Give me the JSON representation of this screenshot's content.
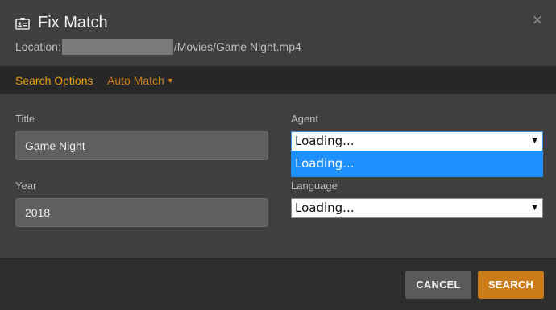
{
  "dialog": {
    "title": "Fix Match",
    "location_label": "Location:",
    "location_path": "/Movies/Game Night.mp4",
    "title_icon": "id-card-icon",
    "close_icon": "close-icon"
  },
  "tabs": {
    "search_options": "Search Options",
    "auto_match": "Auto Match"
  },
  "form": {
    "title_label": "Title",
    "title_value": "Game Night",
    "year_label": "Year",
    "year_value": "2018",
    "agent_label": "Agent",
    "agent_value": "Loading...",
    "agent_option": "Loading...",
    "language_label": "Language",
    "language_value": "Loading..."
  },
  "footer": {
    "cancel_label": "CANCEL",
    "search_label": "SEARCH"
  },
  "colors": {
    "accent": "#e5a00d",
    "button_primary": "#cc7b19",
    "dropdown_highlight": "#1e90ff"
  }
}
